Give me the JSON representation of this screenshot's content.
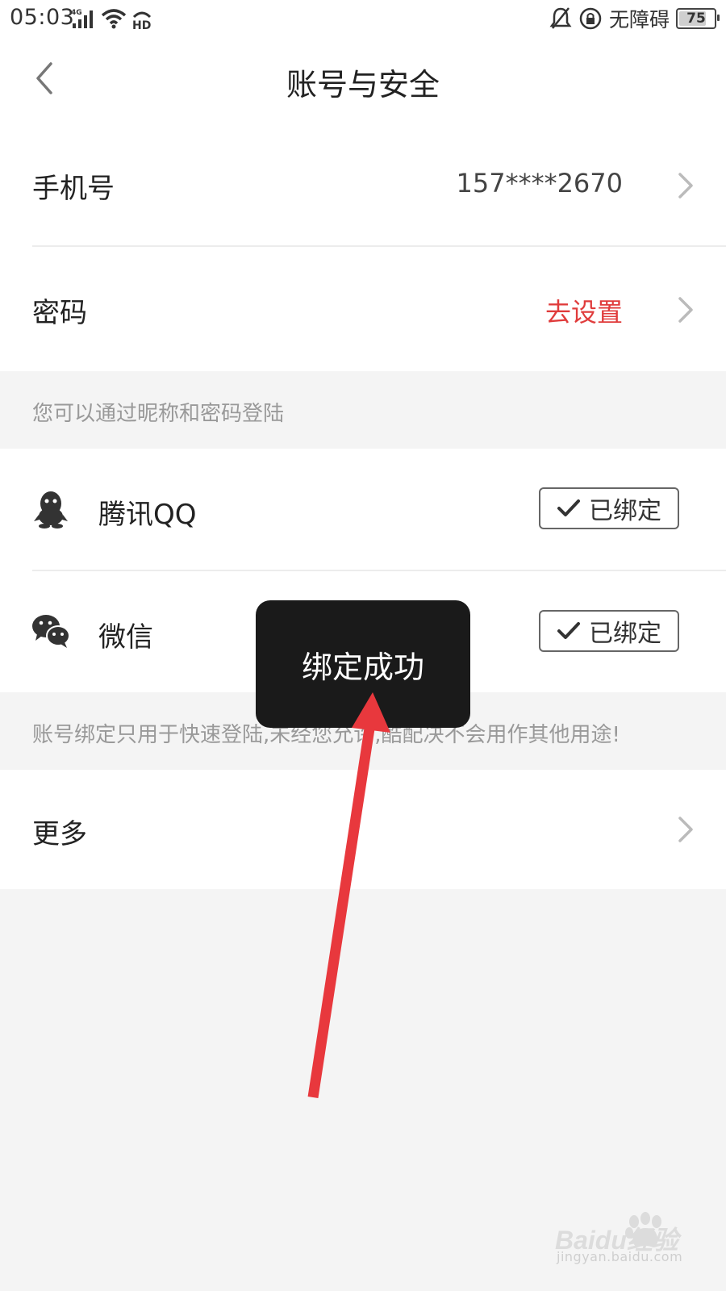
{
  "status_bar": {
    "time": "05:03",
    "network": "4G",
    "accessibility_text": "无障碍",
    "battery_level": "75"
  },
  "header": {
    "title": "账号与安全"
  },
  "account": {
    "phone_label": "手机号",
    "phone_value": "157****2670",
    "password_label": "密码",
    "password_action": "去设置",
    "password_action_color": "#e03c3c",
    "login_hint": "您可以通过昵称和密码登陆"
  },
  "bindings": {
    "items": [
      {
        "label": "腾讯QQ",
        "icon": "qq-icon",
        "status": "已绑定"
      },
      {
        "label": "微信",
        "icon": "wechat-icon",
        "status": "已绑定"
      }
    ],
    "hint": "账号绑定只用于快速登陆,未经您允许,酷配决不会用作其他用途!"
  },
  "more": {
    "label": "更多"
  },
  "toast": {
    "message": "绑定成功"
  },
  "watermark": {
    "brand": "Baidu经验",
    "url": "jingyan.baidu.com"
  },
  "colors": {
    "accent_red": "#e03c3c",
    "annotation_arrow": "#e8383d",
    "toast_bg": "#1a1a1a"
  }
}
